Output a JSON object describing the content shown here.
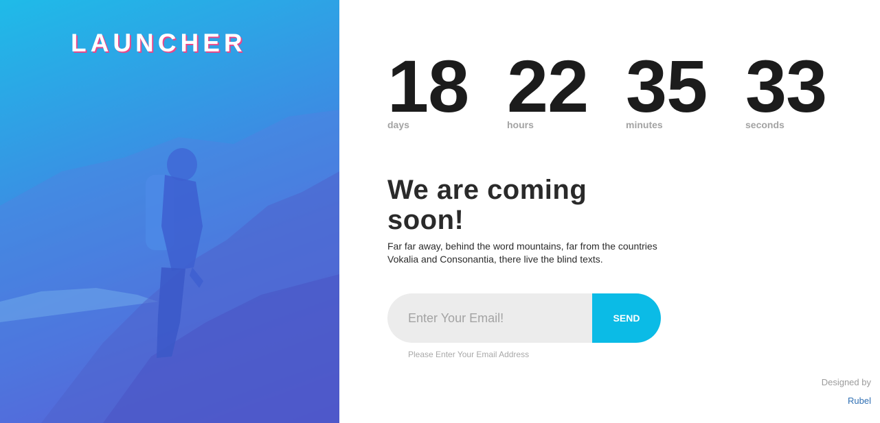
{
  "brand": {
    "logo": "LAUNCHER"
  },
  "countdown": {
    "days": {
      "value": "18",
      "label": "days"
    },
    "hours": {
      "value": "22",
      "label": "hours"
    },
    "minutes": {
      "value": "35",
      "label": "minutes"
    },
    "seconds": {
      "value": "33",
      "label": "seconds"
    }
  },
  "main": {
    "heading": "We are coming soon!",
    "description": "Far far away, behind the word mountains, far from the countries Vokalia and Consonantia, there live the blind texts."
  },
  "subscribe": {
    "email_placeholder": "Enter Your Email!",
    "email_value": "",
    "send_label": "SEND",
    "hint": "Please Enter Your Email Address"
  },
  "footer": {
    "designed_by": "Designed by",
    "designer": "Rubel"
  },
  "colors": {
    "accent": "#0bbbe6",
    "logo_shadow": "#e8488a",
    "gradient_top": "#1fbbe8",
    "gradient_bottom": "#5b4ad3"
  }
}
